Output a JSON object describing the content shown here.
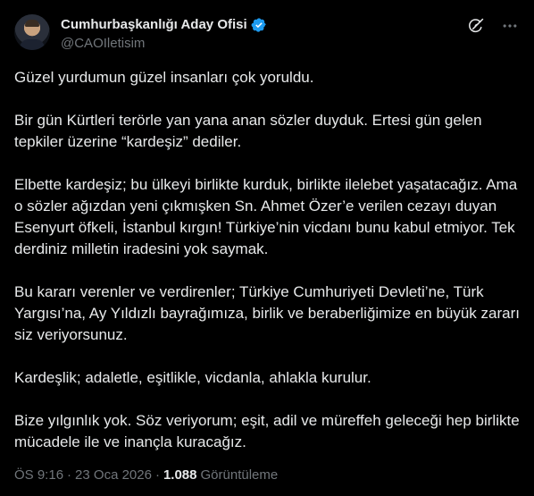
{
  "author": {
    "display_name": "Cumhurbaşkanlığı Aday Ofisi",
    "handle": "@CAOIletisim",
    "verified_color": "#1d9bf0"
  },
  "icons": {
    "avatar": "avatar",
    "verified": "verified-badge-icon",
    "grok": "grok-icon",
    "more": "more-icon"
  },
  "post": {
    "paragraphs": [
      "Güzel yurdumun güzel insanları çok yoruldu.",
      "Bir gün Kürtleri terörle yan yana anan sözler duyduk. Ertesi gün gelen tepkiler üzerine “kardeşiz” dediler.",
      "Elbette kardeşiz; bu ülkeyi birlikte kurduk, birlikte ilelebet yaşatacağız. Ama o sözler ağızdan yeni çıkmışken Sn. Ahmet Özer’e verilen cezayı duyan Esenyurt öfkeli, İstanbul kırgın! Türkiye’nin vicdanı bunu kabul etmiyor. Tek derdiniz milletin iradesini yok saymak.",
      "Bu kararı verenler ve verdirenler; Türkiye Cumhuriyeti Devleti’ne, Türk Yargısı’na, Ay Yıldızlı bayrağımıza, birlik ve beraberliğimize en büyük zararı siz veriyorsunuz.",
      "Kardeşlik; adaletle, eşitlikle, vicdanla, ahlakla kurulur.",
      "Bize yılgınlık yok. Söz veriyorum; eşit, adil ve müreffeh geleceği hep birlikte mücadele ile ve inançla kuracağız."
    ]
  },
  "meta": {
    "time": "ÖS 9:16",
    "separator": "·",
    "date": "23 Oca 2026",
    "views_count": "1.088",
    "views_label": "Görüntüleme"
  }
}
